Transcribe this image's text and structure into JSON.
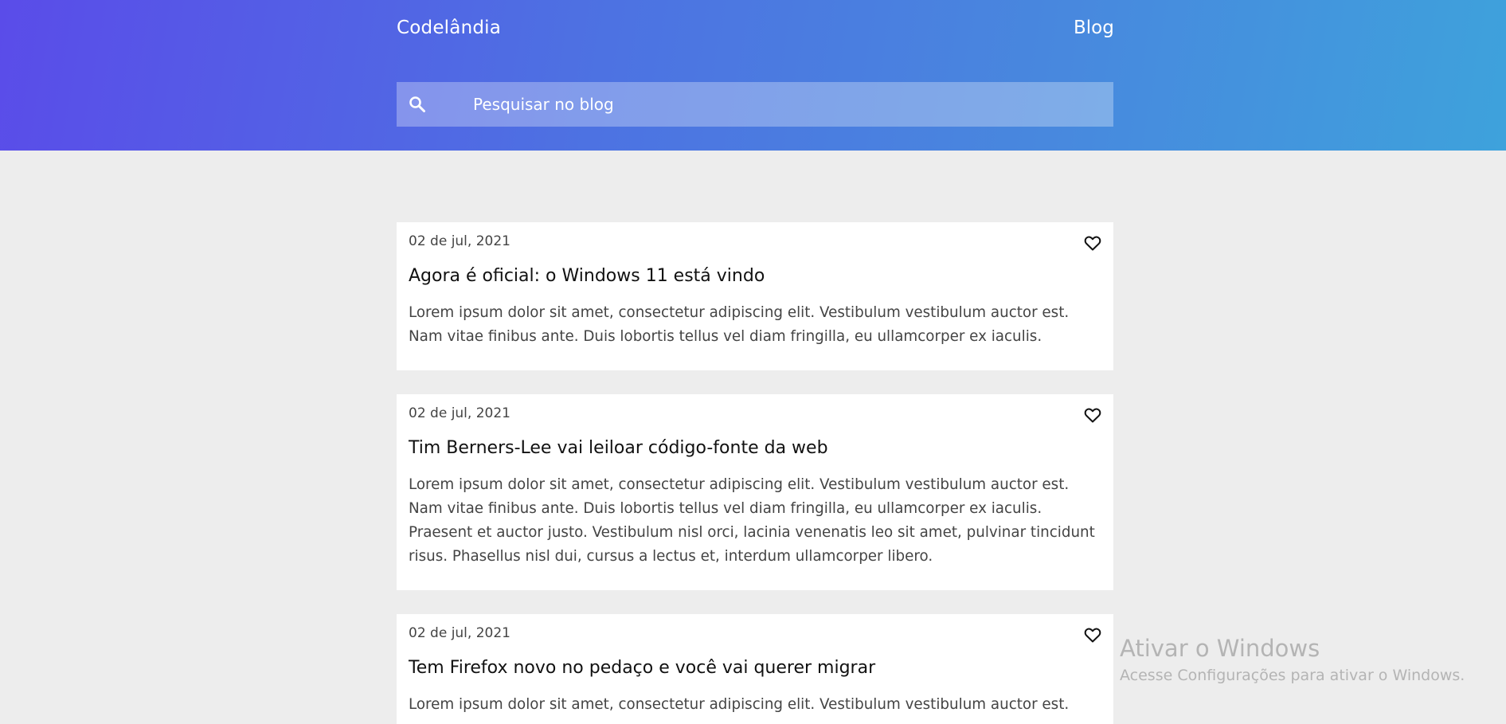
{
  "header": {
    "logo": "Codelândia",
    "nav_blog": "Blog",
    "gradient": [
      "#5a4ce9",
      "#3ea2dc"
    ]
  },
  "search": {
    "placeholder": "Pesquisar no blog",
    "icon": "search-icon"
  },
  "posts": [
    {
      "date": "02 de jul, 2021",
      "title": "Agora é oficial: o Windows 11 está vindo",
      "excerpt": "Lorem ipsum dolor sit amet, consectetur adipiscing elit. Vestibulum vestibulum auctor est. Nam vitae finibus ante. Duis lobortis tellus vel diam fringilla, eu ullamcorper ex iaculis.",
      "icon": "heart-icon"
    },
    {
      "date": "02 de jul, 2021",
      "title": "Tim Berners-Lee vai leiloar código-fonte da web",
      "excerpt": "Lorem ipsum dolor sit amet, consectetur adipiscing elit. Vestibulum vestibulum auctor est. Nam vitae finibus ante. Duis lobortis tellus vel diam fringilla, eu ullamcorper ex iaculis. Praesent et auctor justo. Vestibulum nisl orci, lacinia venenatis leo sit amet, pulvinar tincidunt risus. Phasellus nisl dui, cursus a lectus et, interdum ullamcorper libero.",
      "icon": "heart-icon"
    },
    {
      "date": "02 de jul, 2021",
      "title": "Tem Firefox novo no pedaço e você vai querer migrar",
      "excerpt": "Lorem ipsum dolor sit amet, consectetur adipiscing elit. Vestibulum vestibulum auctor est.",
      "icon": "heart-icon"
    }
  ],
  "watermark": {
    "title": "Ativar o Windows",
    "subtitle": "Acesse Configurações para ativar o Windows."
  }
}
